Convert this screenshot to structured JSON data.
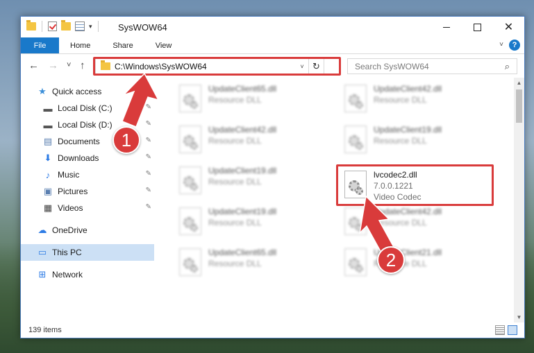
{
  "window": {
    "title": "SysWOW64",
    "controls": {
      "minimize_icon": "minimize-icon",
      "maximize_icon": "maximize-icon",
      "close_glyph": "✕"
    }
  },
  "ribbon": {
    "tabs": [
      "File",
      "Home",
      "Share",
      "View"
    ],
    "help": "?"
  },
  "navbar": {
    "back": "←",
    "forward": "→",
    "recent": "˅",
    "up": "↑",
    "address": "C:\\Windows\\SysWOW64",
    "address_dropdown": "˅",
    "refresh": "↻",
    "search_placeholder": "Search SysWOW64",
    "search_icon": "⌕"
  },
  "sidebar": {
    "quick_access": "Quick access",
    "items": [
      {
        "label": "Local Disk (C:)",
        "icon": "drive-icon",
        "pinned": true
      },
      {
        "label": "Local Disk (D:)",
        "icon": "drive-icon",
        "pinned": true
      },
      {
        "label": "Documents",
        "icon": "documents-icon",
        "pinned": true
      },
      {
        "label": "Downloads",
        "icon": "downloads-icon",
        "pinned": true
      },
      {
        "label": "Music",
        "icon": "music-icon",
        "pinned": true
      },
      {
        "label": "Pictures",
        "icon": "pictures-icon",
        "pinned": true
      },
      {
        "label": "Videos",
        "icon": "videos-icon",
        "pinned": true
      }
    ],
    "onedrive": "OneDrive",
    "this_pc": "This PC",
    "network": "Network",
    "pin_glyph": "📌"
  },
  "files": [
    {
      "name": "UpdateClient65.dll",
      "meta": "Resource DLL",
      "blurred": true
    },
    {
      "name": "UpdateClient42.dll",
      "meta": "Resource DLL",
      "blurred": true
    },
    {
      "name": "UpdateClient42.dll",
      "meta": "Resource DLL",
      "blurred": true
    },
    {
      "name": "UpdateClient19.dll",
      "meta": "Resource DLL",
      "blurred": true
    },
    {
      "name": "UpdateClient19.dll",
      "meta": "Resource DLL",
      "blurred": true
    },
    {
      "name": "lvcodec2.dll",
      "version": "7.0.0.1221",
      "meta": "Video Codec",
      "blurred": false
    },
    {
      "name": "UpdateClient19.dll",
      "meta": "Resource DLL",
      "blurred": true
    },
    {
      "name": "UpdateClient42.dll",
      "meta": "Resource DLL",
      "blurred": true
    },
    {
      "name": "UpdateClient65.dll",
      "meta": "Resource DLL",
      "blurred": true
    },
    {
      "name": "UpdateClient21.dll",
      "meta": "Resource DLL",
      "blurred": true
    }
  ],
  "status": {
    "count": "139 items"
  },
  "annotations": {
    "step1": "1",
    "step2": "2",
    "color": "#d93b3b"
  }
}
